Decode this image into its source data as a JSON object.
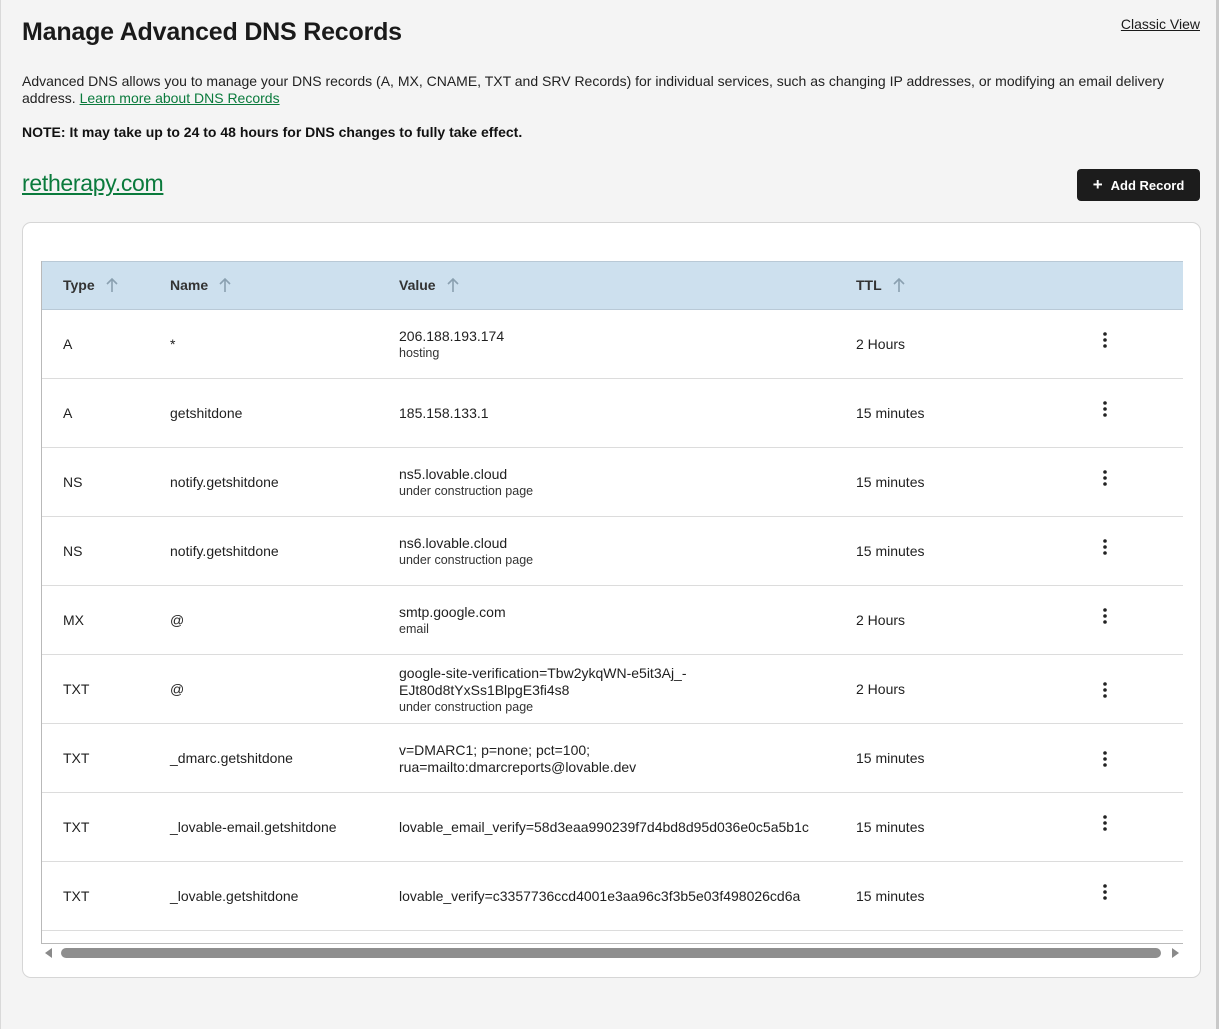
{
  "header": {
    "title": "Manage Advanced DNS Records",
    "classic_view_label": "Classic View"
  },
  "intro": {
    "text": "Advanced DNS allows you to manage your DNS records (A, MX, CNAME, TXT and SRV Records) for individual services, such as changing IP addresses, or modifying an email delivery address.",
    "learn_more_label": "Learn more about DNS Records"
  },
  "note": "NOTE: It may take up to 24 to 48 hours for DNS changes to fully take effect.",
  "domain": "retherapy.com",
  "add_record_label": "Add Record",
  "table": {
    "columns": {
      "type": "Type",
      "name": "Name",
      "value": "Value",
      "ttl": "TTL"
    },
    "rows": [
      {
        "type": "A",
        "name": "*",
        "value": "206.188.193.174",
        "sub": "hosting",
        "ttl": "2 Hours"
      },
      {
        "type": "A",
        "name": "getshitdone",
        "value": "185.158.133.1",
        "sub": "",
        "ttl": "15 minutes"
      },
      {
        "type": "NS",
        "name": "notify.getshitdone",
        "value": "ns5.lovable.cloud",
        "sub": "under construction page",
        "ttl": "15 minutes"
      },
      {
        "type": "NS",
        "name": "notify.getshitdone",
        "value": "ns6.lovable.cloud",
        "sub": "under construction page",
        "ttl": "15 minutes"
      },
      {
        "type": "MX",
        "name": "@",
        "value": "smtp.google.com",
        "sub": "email",
        "ttl": "2 Hours"
      },
      {
        "type": "TXT",
        "name": "@",
        "value": "google-site-verification=Tbw2ykqWN-e5it3Aj_-EJt80d8tYxSs1BlpgE3fi4s8",
        "sub": "under construction page",
        "ttl": "2 Hours"
      },
      {
        "type": "TXT",
        "name": "_dmarc.getshitdone",
        "value": "v=DMARC1; p=none; pct=100; rua=mailto:dmarcreports@lovable.dev",
        "sub": "",
        "ttl": "15 minutes"
      },
      {
        "type": "TXT",
        "name": "_lovable-email.getshitdone",
        "value": "lovable_email_verify=58d3eaa990239f7d4bd8d95d036e0c5a5b1c",
        "sub": "",
        "ttl": "15 minutes"
      },
      {
        "type": "TXT",
        "name": "_lovable.getshitdone",
        "value": "lovable_verify=c3357736ccd4001e3aa96c3f3b5e03f498026cd6a",
        "sub": "",
        "ttl": "15 minutes"
      }
    ]
  },
  "icons": {
    "sort": "arrow-up-icon",
    "row_menu": "kebab-menu-icon",
    "add": "plus-icon"
  },
  "colors": {
    "link_green": "#0a7a3c",
    "header_blue": "#cde0ee",
    "button_dark": "#1c1c1c"
  }
}
